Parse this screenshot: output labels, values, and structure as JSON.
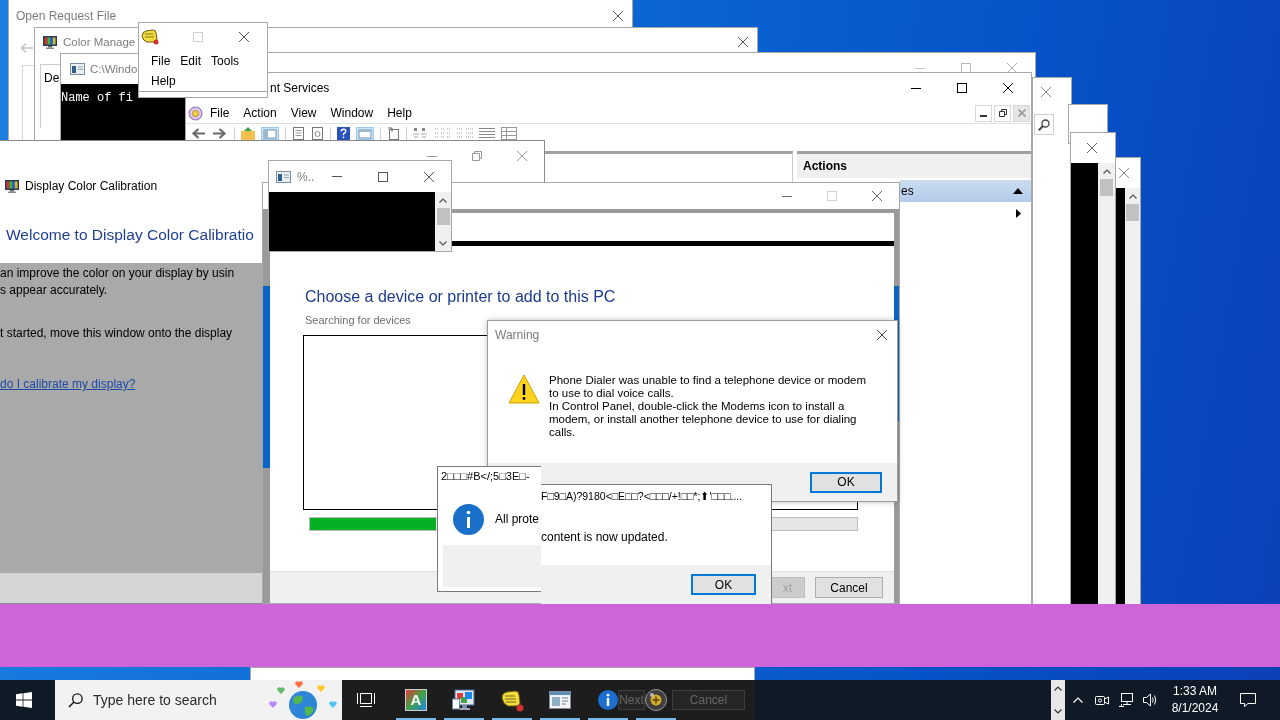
{
  "open_request_window": {
    "title": "Open Request File"
  },
  "color_management_window": {
    "title": "Color Manage",
    "tab": "De"
  },
  "console_window": {
    "title": "C:\\Windo",
    "output": "Name of fi"
  },
  "menu_window": {
    "menu": [
      "File",
      "Edit",
      "Tools",
      "Help"
    ]
  },
  "services_window": {
    "title": "nt Services",
    "menu": [
      "File",
      "Action",
      "View",
      "Window",
      "Help"
    ],
    "actions_pane": {
      "header": "Actions",
      "items": [
        {
          "label": "es",
          "selected": true
        }
      ]
    }
  },
  "calibration_window": {
    "title": "Display Color Calibration",
    "heading": "Welcome to Display Color Calibratio",
    "paragraphs": [
      [
        "an improve the color on your display by usin",
        "s appear accurately."
      ],
      [
        "t started, move this window onto the display"
      ]
    ],
    "link": "do I calibrate my display?"
  },
  "small_console_window": {
    "title": "%.."
  },
  "add_device_window": {
    "heading": "Choose a device or printer to add to this PC",
    "status": "Searching for devices",
    "progress": {
      "level": 0.23
    },
    "buttons": [
      {
        "label": "xt",
        "disabled": true
      },
      {
        "label": "Cancel",
        "disabled": false
      }
    ]
  },
  "warning_dialog": {
    "title": "Warning",
    "message": [
      "Phone Dialer was unable to find a telephone device or modem to use to dial voice calls.",
      "In Control Panel, double-click the Modems icon to install a modem, or install another telephone device to use for dialing calls."
    ],
    "button": {
      "label": "OK",
      "default": true
    }
  },
  "info_dialog": {
    "title": "2□□□#B</;5□3E□-",
    "message": "All prote"
  },
  "info_dialog_2": {
    "title": "F□9□A)?9180<□E□□?<□□□/+!□□*;⬆'□□□....",
    "message": "content is now updated.",
    "button": {
      "label": "OK",
      "default": true
    }
  },
  "window_behind_taskbar": {
    "buttons": [
      "Next",
      "Cancel"
    ]
  },
  "taskbar": {
    "search": {
      "placeholder": "Type here to search"
    },
    "apps": [
      {
        "kind": "font",
        "glyph": "A",
        "running": true
      },
      {
        "kind": "display",
        "running": true
      },
      {
        "kind": "hand",
        "running": true
      },
      {
        "kind": "window",
        "running": true
      },
      {
        "kind": "info",
        "running": true
      },
      {
        "kind": "sphere",
        "running": true
      }
    ],
    "clock": {
      "time": "1:33 AM",
      "date": "8/1/2024"
    }
  }
}
